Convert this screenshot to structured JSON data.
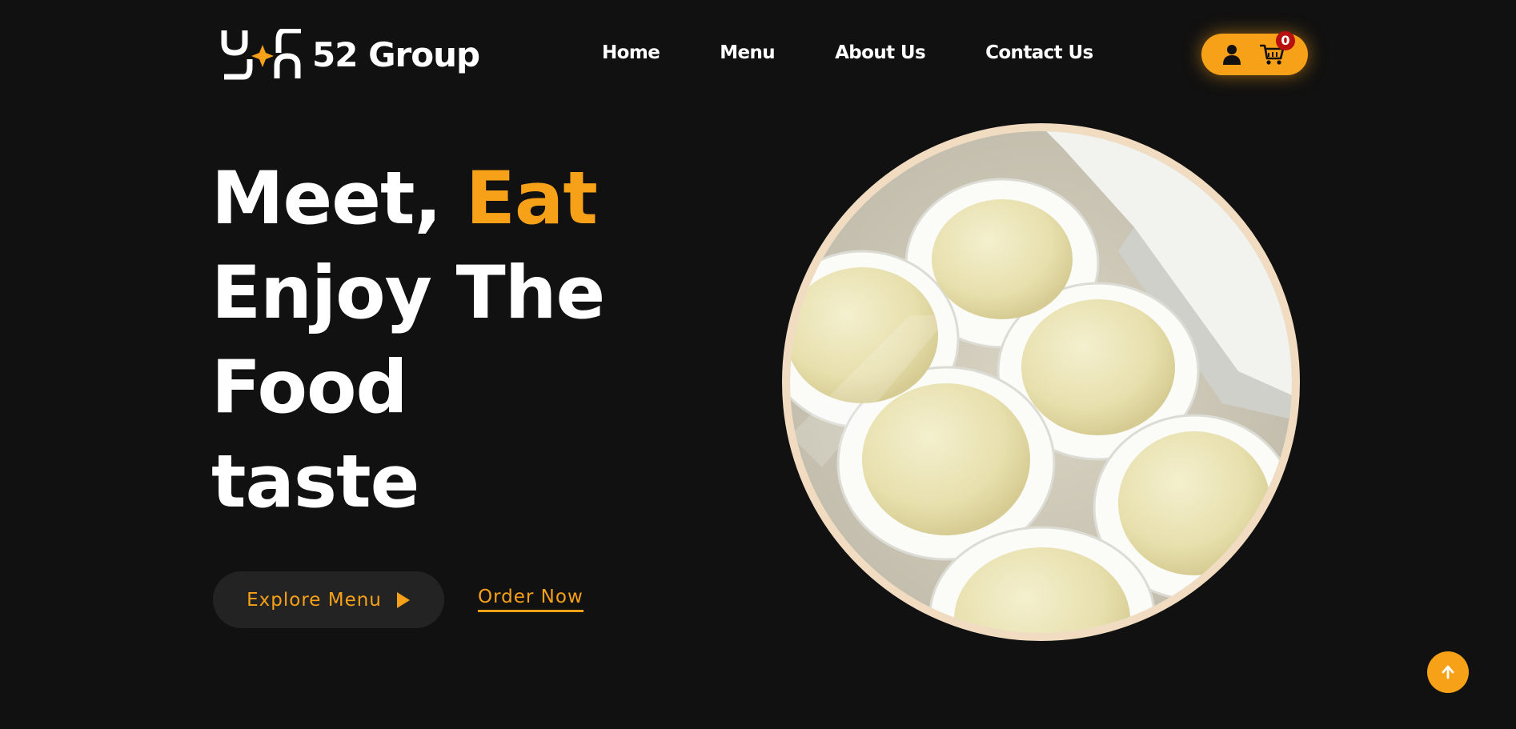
{
  "brand": {
    "name": "52 Group",
    "accent": "#f7a118",
    "background": "#111111"
  },
  "nav": {
    "items": [
      {
        "label": "Home"
      },
      {
        "label": "Menu"
      },
      {
        "label": "About Us"
      },
      {
        "label": "Contact Us"
      }
    ]
  },
  "actions": {
    "user_icon": "user-icon",
    "cart_icon": "cart-icon",
    "cart_count": "0"
  },
  "hero": {
    "title_part1": "Meet,",
    "title_highlight": "Eat",
    "title_line2": "Enjoy The",
    "title_line3": "Food",
    "title_line4": "taste",
    "explore_label": "Explore Menu",
    "order_label": "Order Now",
    "image_alt": "Mochi"
  },
  "scroll_top_icon": "arrow-up-icon"
}
